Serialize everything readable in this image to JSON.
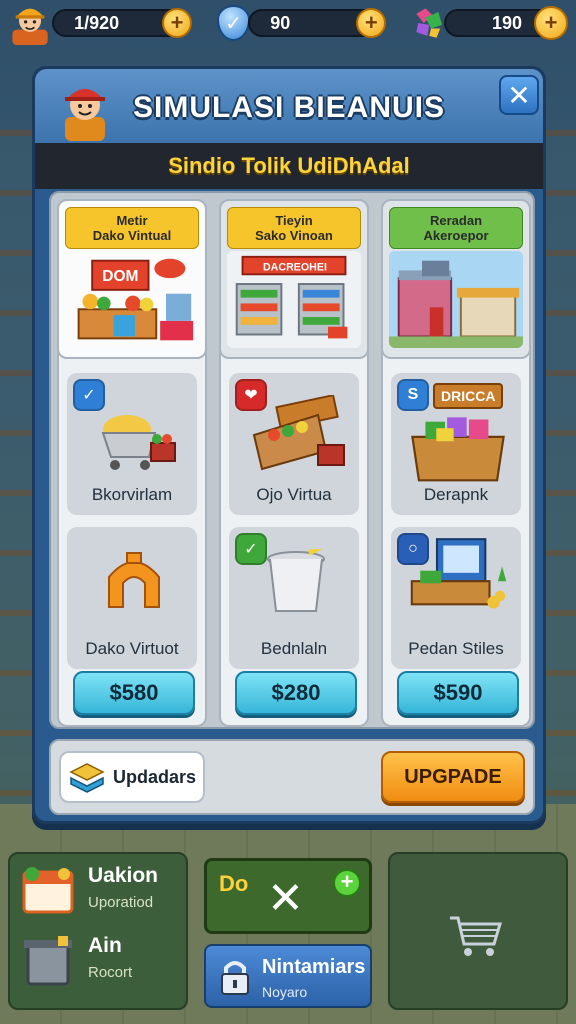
{
  "topbar": {
    "coins": {
      "value": "1/920",
      "plus": "+"
    },
    "energy": {
      "value": "90",
      "plus": "+"
    },
    "gems": {
      "value": "190",
      "plus": "+"
    }
  },
  "modal": {
    "title": "SIMULASI BIEANUIS",
    "subtitle": "Sindio Tolik UdiDhAdal",
    "close_label": "✕"
  },
  "columns": [
    {
      "card_title": "Metir\nDako Vintual",
      "card_color": "yellow",
      "card_sign": "DOM",
      "items": [
        {
          "badge": "✓",
          "badge_color": "blue",
          "label": "Bkorvirlam",
          "tag": ""
        },
        {
          "badge": "",
          "badge_color": "",
          "label": "Dako Virtuot",
          "tag": ""
        }
      ],
      "price": "$580"
    },
    {
      "card_title": "Tieyin\nSako Vinoan",
      "card_color": "yellow",
      "card_sign": "DACREOHEI",
      "items": [
        {
          "badge": "❤",
          "badge_color": "red",
          "label": "Ojo Virtua",
          "tag": ""
        },
        {
          "badge": "✓",
          "badge_color": "green",
          "label": "Bednlaln",
          "tag": ""
        }
      ],
      "price": "$280"
    },
    {
      "card_title": "Reradan\nAkeroepor",
      "card_color": "green",
      "card_sign": "",
      "items": [
        {
          "badge": "S",
          "badge_color": "blue",
          "label": "Derapnk",
          "tag": "DRICCA"
        },
        {
          "badge": "○",
          "badge_color": "navy",
          "label": "Pedan Stiles",
          "tag": ""
        }
      ],
      "price": "$590"
    }
  ],
  "footer": {
    "updaters_label": "Updadars",
    "upgrade_label": "UPGPADE"
  },
  "bottom": {
    "left": [
      {
        "title": "Uakion",
        "sub": "Uporatiod"
      },
      {
        "title": "Ain",
        "sub": "Rocort"
      }
    ],
    "mid_top_label": "Do",
    "mid_top_x": "✕",
    "mid_top_plus": "+",
    "mid_bottom": {
      "title": "Nintamiars",
      "sub": "Noyaro"
    }
  },
  "colors": {
    "modal": "#2a5b8e",
    "price_button": "#36b6d9",
    "upgrade_button": "#f08c12",
    "accent_gold": "#ffd33a"
  },
  "icons": [
    "player-avatar-icon",
    "coin-plus-icon",
    "shield-energy-icon",
    "gem-icon",
    "close-icon",
    "shopping-cart-icon",
    "lock-icon",
    "crate-icon",
    "trash-icon"
  ]
}
